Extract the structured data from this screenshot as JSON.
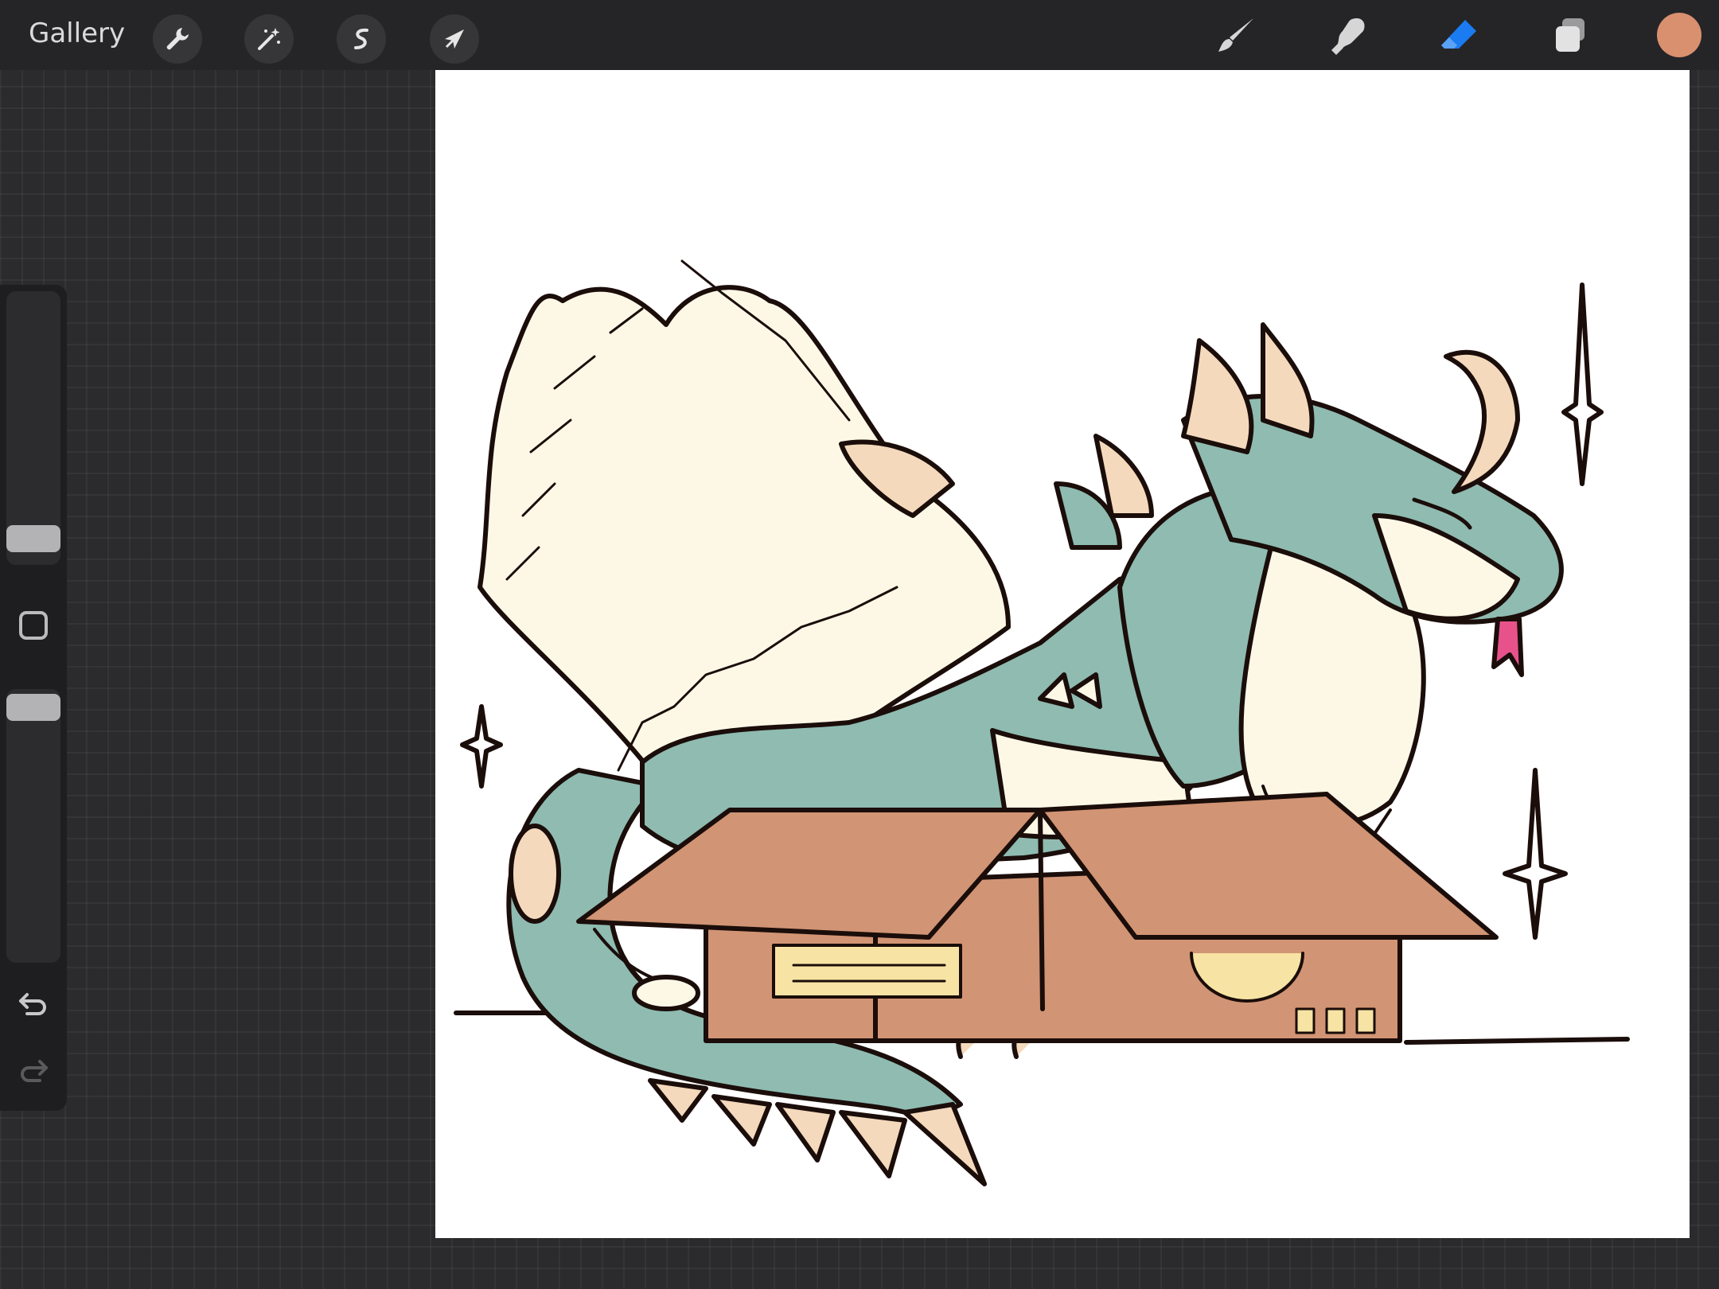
{
  "toolbar": {
    "gallery_label": "Gallery",
    "left_tools": [
      {
        "name": "actions",
        "icon": "wrench-icon"
      },
      {
        "name": "adjustments",
        "icon": "magic-wand-icon"
      },
      {
        "name": "selection",
        "icon": "selection-s-icon"
      },
      {
        "name": "transform",
        "icon": "arrow-cursor-icon"
      }
    ],
    "right_tools": [
      {
        "name": "brush",
        "icon": "brush-icon",
        "active": false
      },
      {
        "name": "smudge",
        "icon": "smudge-finger-icon",
        "active": false
      },
      {
        "name": "eraser",
        "icon": "eraser-icon",
        "active": true
      },
      {
        "name": "layers",
        "icon": "layers-icon",
        "active": false
      }
    ],
    "current_color": "#d8906f",
    "active_tool_color": "#1a7cf0"
  },
  "sidebar": {
    "brush_size_level": 0.2,
    "opacity_level": 1.0,
    "buttons": [
      "modify-square-icon",
      "undo-icon",
      "redo-icon"
    ]
  },
  "canvas": {
    "background": "#ffffff",
    "palette": {
      "teal": "#8fbbb1",
      "cream": "#fdf8e6",
      "peach": "#f4d9bc",
      "box_brown": "#d19474",
      "label_yellow": "#f7e4a4",
      "tongue_pink": "#e8528a",
      "ink": "#1a0d0a"
    }
  }
}
